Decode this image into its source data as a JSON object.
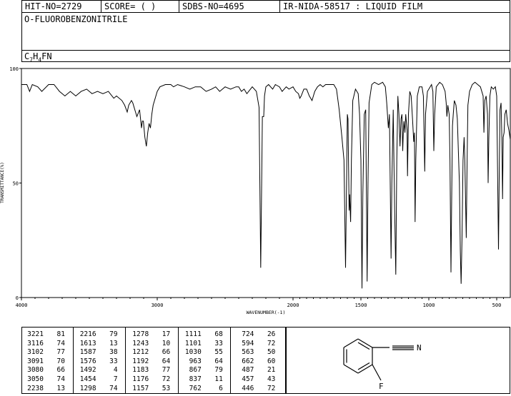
{
  "header": {
    "hit_no": "HIT-NO=2729",
    "score": "SCORE=  (  )",
    "sdbs_no": "SDBS-NO=4695",
    "ir_nida": "IR-NIDA-58517 : LIQUID FILM"
  },
  "compound": {
    "name": "O-FLUOROBENZONITRILE",
    "formula_c": "C",
    "formula_c_sub": "7",
    "formula_h": "H",
    "formula_h_sub": "4",
    "formula_rest": "FN"
  },
  "chart_data": {
    "type": "line",
    "title": "",
    "xlabel": "WAVENUMBER(-1)",
    "ylabel": "TRANSMITTANCE(%)",
    "xlim": [
      4000,
      400
    ],
    "ylim": [
      0,
      100
    ],
    "x_ticks": [
      4000,
      3000,
      2000,
      1500,
      1000,
      500
    ],
    "x_tick_labels": [
      "4000",
      "3000",
      "2000",
      "1500",
      "1000",
      "500"
    ],
    "y_ticks": [
      0,
      50,
      100
    ],
    "y_tick_labels": [
      "0",
      "50",
      "100"
    ],
    "baseline": [
      [
        4000,
        93
      ],
      [
        3960,
        93
      ],
      [
        3940,
        90
      ],
      [
        3920,
        93
      ],
      [
        3880,
        92
      ],
      [
        3850,
        90
      ],
      [
        3800,
        93
      ],
      [
        3760,
        93
      ],
      [
        3720,
        90
      ],
      [
        3700,
        89
      ],
      [
        3680,
        88
      ],
      [
        3640,
        90
      ],
      [
        3600,
        88
      ],
      [
        3560,
        90
      ],
      [
        3520,
        91
      ],
      [
        3480,
        89
      ],
      [
        3440,
        90
      ],
      [
        3400,
        89
      ],
      [
        3360,
        90
      ],
      [
        3320,
        87
      ],
      [
        3300,
        88
      ],
      [
        3260,
        86
      ],
      [
        3240,
        84
      ],
      [
        3221,
        81
      ],
      [
        3210,
        84
      ],
      [
        3190,
        86
      ],
      [
        3180,
        85
      ],
      [
        3150,
        79
      ],
      [
        3130,
        82
      ],
      [
        3116,
        74
      ],
      [
        3110,
        77
      ],
      [
        3102,
        77
      ],
      [
        3091,
        70
      ],
      [
        3080,
        66
      ],
      [
        3070,
        72
      ],
      [
        3060,
        76
      ],
      [
        3050,
        74
      ],
      [
        3040,
        80
      ],
      [
        3030,
        84
      ],
      [
        3000,
        90
      ],
      [
        2980,
        92
      ],
      [
        2940,
        93
      ],
      [
        2900,
        93
      ],
      [
        2880,
        92
      ],
      [
        2850,
        93
      ],
      [
        2800,
        92
      ],
      [
        2760,
        91
      ],
      [
        2720,
        92
      ],
      [
        2680,
        92
      ],
      [
        2640,
        90
      ],
      [
        2600,
        91
      ],
      [
        2570,
        92
      ],
      [
        2540,
        90
      ],
      [
        2500,
        92
      ],
      [
        2460,
        91
      ],
      [
        2420,
        92
      ],
      [
        2400,
        92
      ],
      [
        2380,
        90
      ],
      [
        2360,
        91
      ],
      [
        2340,
        89
      ],
      [
        2300,
        92
      ],
      [
        2270,
        90
      ],
      [
        2250,
        83
      ],
      [
        2238,
        13
      ],
      [
        2230,
        55
      ],
      [
        2226,
        79
      ],
      [
        2216,
        79
      ],
      [
        2210,
        88
      ],
      [
        2200,
        92
      ],
      [
        2180,
        93
      ],
      [
        2150,
        91
      ],
      [
        2130,
        93
      ],
      [
        2100,
        92
      ],
      [
        2080,
        90
      ],
      [
        2050,
        92
      ],
      [
        2030,
        91
      ],
      [
        2000,
        92
      ],
      [
        1980,
        90
      ],
      [
        1960,
        89
      ],
      [
        1950,
        87
      ],
      [
        1940,
        88
      ],
      [
        1920,
        91
      ],
      [
        1900,
        91
      ],
      [
        1880,
        88
      ],
      [
        1860,
        86
      ],
      [
        1840,
        90
      ],
      [
        1820,
        92
      ],
      [
        1800,
        93
      ],
      [
        1780,
        92
      ],
      [
        1760,
        93
      ],
      [
        1740,
        93
      ],
      [
        1700,
        93
      ],
      [
        1680,
        91
      ],
      [
        1660,
        82
      ],
      [
        1640,
        70
      ],
      [
        1625,
        60
      ],
      [
        1613,
        13
      ],
      [
        1608,
        40
      ],
      [
        1600,
        80
      ],
      [
        1595,
        78
      ],
      [
        1587,
        38
      ],
      [
        1583,
        45
      ],
      [
        1576,
        33
      ],
      [
        1570,
        60
      ],
      [
        1560,
        86
      ],
      [
        1540,
        91
      ],
      [
        1520,
        89
      ],
      [
        1510,
        80
      ],
      [
        1500,
        60
      ],
      [
        1492,
        4
      ],
      [
        1486,
        45
      ],
      [
        1475,
        80
      ],
      [
        1465,
        82
      ],
      [
        1454,
        7
      ],
      [
        1448,
        50
      ],
      [
        1440,
        85
      ],
      [
        1420,
        93
      ],
      [
        1400,
        94
      ],
      [
        1370,
        93
      ],
      [
        1340,
        94
      ],
      [
        1320,
        92
      ],
      [
        1310,
        85
      ],
      [
        1298,
        74
      ],
      [
        1290,
        80
      ],
      [
        1278,
        17
      ],
      [
        1272,
        50
      ],
      [
        1262,
        82
      ],
      [
        1252,
        40
      ],
      [
        1243,
        10
      ],
      [
        1236,
        60
      ],
      [
        1228,
        88
      ],
      [
        1220,
        80
      ],
      [
        1212,
        66
      ],
      [
        1205,
        78
      ],
      [
        1198,
        80
      ],
      [
        1192,
        64
      ],
      [
        1188,
        72
      ],
      [
        1183,
        77
      ],
      [
        1176,
        72
      ],
      [
        1170,
        80
      ],
      [
        1160,
        73
      ],
      [
        1157,
        53
      ],
      [
        1150,
        80
      ],
      [
        1140,
        90
      ],
      [
        1130,
        88
      ],
      [
        1120,
        78
      ],
      [
        1111,
        68
      ],
      [
        1106,
        72
      ],
      [
        1101,
        33
      ],
      [
        1096,
        60
      ],
      [
        1085,
        88
      ],
      [
        1070,
        92
      ],
      [
        1050,
        92
      ],
      [
        1040,
        88
      ],
      [
        1030,
        55
      ],
      [
        1024,
        80
      ],
      [
        1010,
        90
      ],
      [
        990,
        92
      ],
      [
        980,
        93
      ],
      [
        970,
        90
      ],
      [
        963,
        64
      ],
      [
        957,
        80
      ],
      [
        945,
        92
      ],
      [
        920,
        94
      ],
      [
        900,
        93
      ],
      [
        880,
        90
      ],
      [
        872,
        85
      ],
      [
        867,
        79
      ],
      [
        860,
        84
      ],
      [
        850,
        80
      ],
      [
        844,
        60
      ],
      [
        837,
        11
      ],
      [
        832,
        40
      ],
      [
        826,
        75
      ],
      [
        820,
        80
      ],
      [
        812,
        86
      ],
      [
        800,
        84
      ],
      [
        790,
        78
      ],
      [
        775,
        50
      ],
      [
        768,
        20
      ],
      [
        762,
        6
      ],
      [
        756,
        25
      ],
      [
        748,
        60
      ],
      [
        740,
        70
      ],
      [
        735,
        60
      ],
      [
        724,
        26
      ],
      [
        718,
        60
      ],
      [
        712,
        84
      ],
      [
        700,
        90
      ],
      [
        680,
        93
      ],
      [
        660,
        94
      ],
      [
        640,
        93
      ],
      [
        620,
        92
      ],
      [
        600,
        88
      ],
      [
        594,
        72
      ],
      [
        588,
        86
      ],
      [
        578,
        88
      ],
      [
        568,
        80
      ],
      [
        563,
        50
      ],
      [
        558,
        70
      ],
      [
        550,
        88
      ],
      [
        540,
        92
      ],
      [
        525,
        91
      ],
      [
        510,
        92
      ],
      [
        500,
        88
      ],
      [
        487,
        21
      ],
      [
        482,
        50
      ],
      [
        476,
        82
      ],
      [
        468,
        85
      ],
      [
        462,
        70
      ],
      [
        457,
        43
      ],
      [
        452,
        70
      ],
      [
        446,
        72
      ],
      [
        440,
        80
      ],
      [
        430,
        82
      ],
      [
        420,
        76
      ],
      [
        410,
        73
      ],
      [
        400,
        69
      ]
    ],
    "peaks": [
      [
        [
          3221,
          81
        ],
        [
          3116,
          74
        ],
        [
          3102,
          77
        ],
        [
          3091,
          70
        ],
        [
          3080,
          66
        ],
        [
          3050,
          74
        ],
        [
          2238,
          13
        ]
      ],
      [
        [
          2216,
          79
        ],
        [
          1613,
          13
        ],
        [
          1587,
          38
        ],
        [
          1576,
          33
        ],
        [
          1492,
          4
        ],
        [
          1454,
          7
        ],
        [
          1298,
          74
        ]
      ],
      [
        [
          1278,
          17
        ],
        [
          1243,
          10
        ],
        [
          1212,
          66
        ],
        [
          1192,
          64
        ],
        [
          1183,
          77
        ],
        [
          1176,
          72
        ],
        [
          1157,
          53
        ]
      ],
      [
        [
          1111,
          68
        ],
        [
          1101,
          33
        ],
        [
          1030,
          55
        ],
        [
          963,
          64
        ],
        [
          867,
          79
        ],
        [
          837,
          11
        ],
        [
          762,
          6
        ]
      ],
      [
        [
          724,
          26
        ],
        [
          594,
          72
        ],
        [
          563,
          50
        ],
        [
          662,
          60
        ],
        [
          487,
          21
        ],
        [
          457,
          43
        ],
        [
          446,
          72
        ]
      ]
    ]
  },
  "structure": {
    "substituent_label": "F",
    "nitrile_label": "N"
  }
}
